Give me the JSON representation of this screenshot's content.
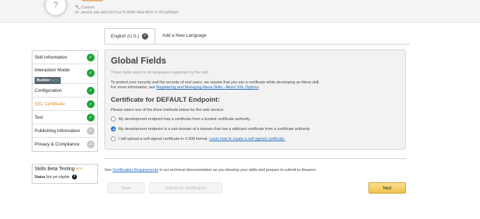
{
  "header": {
    "icon_glyph": "?",
    "skill_type": "Custom",
    "skill_id_label": "ID:",
    "skill_id": "amzn1.ask.skill.5217ca78-2699-49af-8fc0-7c757a2f0bd7"
  },
  "tabs": [
    {
      "label": "English (U.S.)",
      "check": "✓"
    },
    {
      "label": "Add a New Language"
    }
  ],
  "sidebar": {
    "items": [
      {
        "label": "Skill Information",
        "status": "done"
      },
      {
        "label": "Interaction Model",
        "badge": "Builder",
        "badge_tag": "BETA",
        "status": "done"
      },
      {
        "label": "Configuration",
        "status": "done"
      },
      {
        "label": "SSL Certificate",
        "status": "done",
        "active": true
      },
      {
        "label": "Test",
        "status": "done"
      },
      {
        "label": "Publishing Information",
        "status": "todo"
      },
      {
        "label": "Privacy & Compliance",
        "status": "todo"
      }
    ],
    "check_glyph": "✓"
  },
  "beta_testing": {
    "title": "Skills Beta Testing",
    "new_tag": "NEW",
    "status_label": "Status",
    "status_value": "Not yet eligible",
    "info_glyph": "i"
  },
  "panel": {
    "title": "Global Fields",
    "subtitle": "These fields apply to all languages supported by the skill.",
    "para_line1": "To protect your security and the security of end users, we require that you use a certificate while developing an Alexa skill.",
    "para_line2_prefix": "For more information, see ",
    "para_link": "Registering and Managing Alexa Skills - About SSL Options",
    "para_line2_suffix": ".",
    "cert_heading": "Certificate for DEFAULT Endpoint:",
    "instruction": "Please select one of the three methods below for the web service:",
    "options": [
      {
        "label": "My development endpoint has a certificate from a trusted certificate authority",
        "selected": false
      },
      {
        "label": "My development endpoint is a sub-domain of a domain that has a wildcard certificate from a certificate authority",
        "selected": true
      },
      {
        "label": "I will upload a self-signed certificate in X.509 format. ",
        "link": "Learn how to create a self signed certificate.",
        "selected": false
      }
    ]
  },
  "footnote": {
    "prefix": "See ",
    "link": "Certification Requirements",
    "suffix": " in our technical documentation as you develop your skills and prepare to submit to Amazon."
  },
  "buttons": {
    "save": "Save",
    "submit": "Submit for certification",
    "next": "Next"
  },
  "colors": {
    "done": "#1ea337",
    "todo": "#c9c9c9",
    "active_item": "#e08a26",
    "link": "#1a6bc0",
    "next_button": "#f0c14b"
  }
}
